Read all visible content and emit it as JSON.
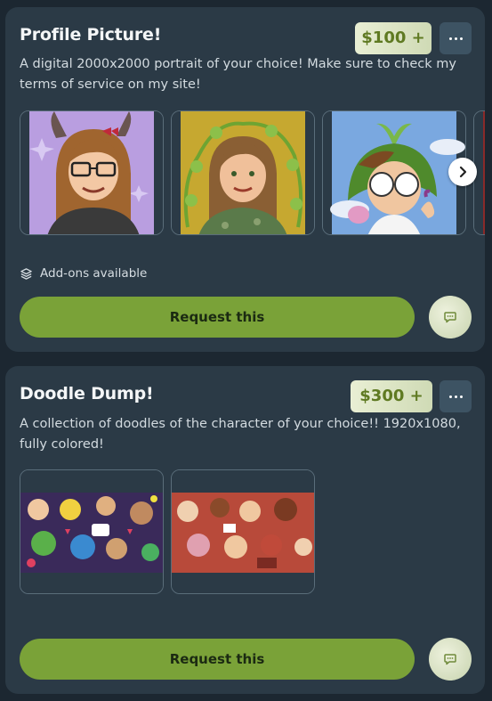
{
  "cards": [
    {
      "title": "Profile Picture!",
      "price": "$100 +",
      "description": "A digital 2000x2000 portrait of your choice! Make sure to check my terms of service on my site!",
      "addons_label": "Add-ons available",
      "request_label": "Request this",
      "gallery_images": [
        "portrait-horned-girl-glasses",
        "portrait-woman-vines-yellow",
        "portrait-character-sprout-hat",
        "portrait-partial-fourth"
      ],
      "next_icon": "chevron-right-icon",
      "more_icon": "ellipsis-icon",
      "chat_icon": "chat-bubble-icon"
    },
    {
      "title": "Doodle Dump!",
      "price": "$300 +",
      "description": "A collection of doodles of the character of your choice!! 1920x1080, fully colored!",
      "request_label": "Request this",
      "gallery_images": [
        "doodle-collage-purple",
        "doodle-collage-red"
      ],
      "more_icon": "ellipsis-icon",
      "chat_icon": "chat-bubble-icon"
    }
  ],
  "colors": {
    "background": "#1c2731",
    "card": "#2b3a46",
    "request_button": "#7aa238",
    "price_text": "#5f7a22",
    "price_bg": "#e9efd4",
    "more_button": "#3d5363"
  }
}
